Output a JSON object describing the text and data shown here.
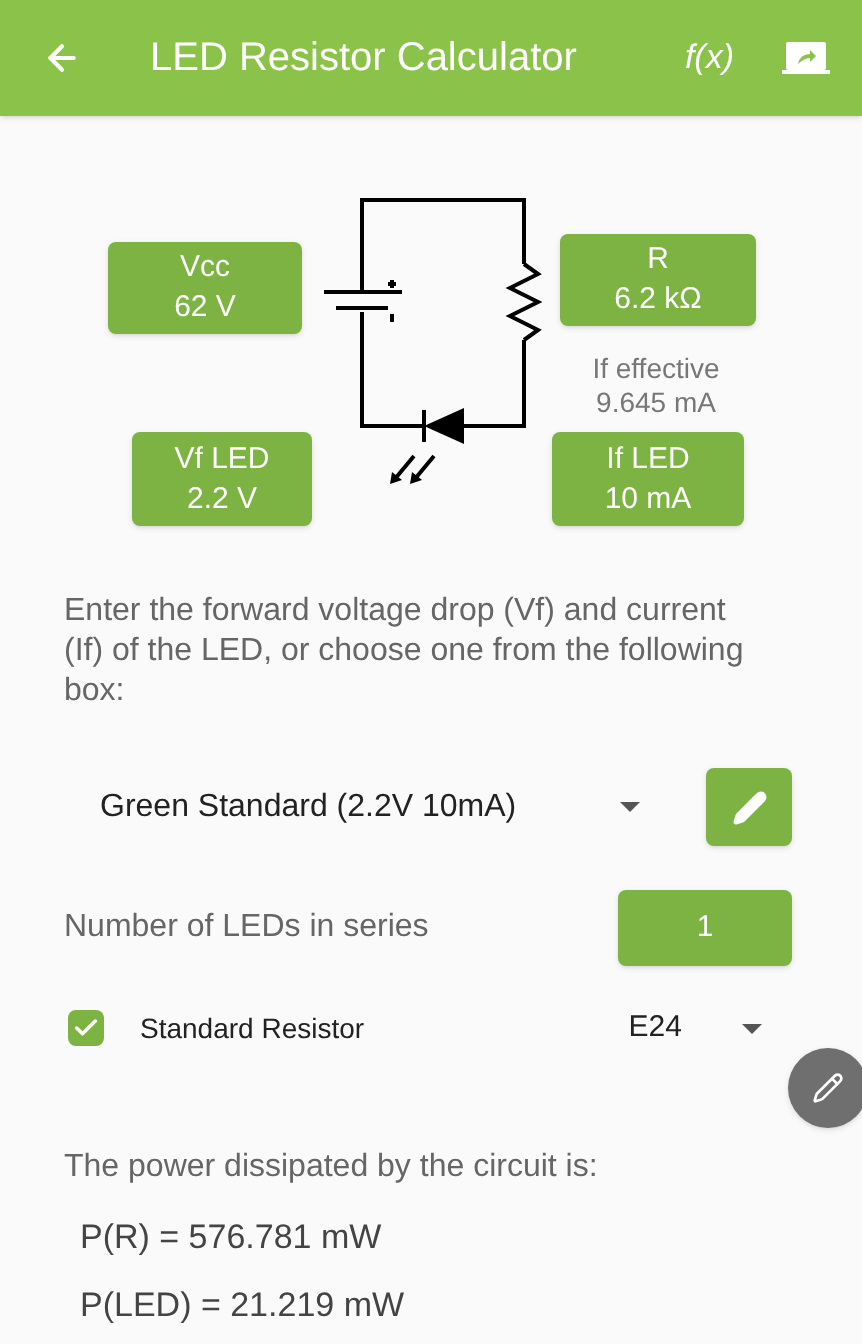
{
  "app_bar": {
    "title": "LED Resistor Calculator",
    "function_label": "f(x)"
  },
  "circuit": {
    "vcc": {
      "label": "Vcc",
      "value": "62 V"
    },
    "r": {
      "label": "R",
      "value": "6.2 kΩ"
    },
    "if_effective": {
      "label": "If effective",
      "value": "9.645 mA"
    },
    "vf_led": {
      "label": "Vf LED",
      "value": "2.2 V"
    },
    "if_led": {
      "label": "If LED",
      "value": "10 mA"
    }
  },
  "instructions": "Enter the forward voltage drop (Vf) and current (If) of the LED, or choose one from the following box:",
  "led_preset": {
    "value": "Green Standard (2.2V 10mA)"
  },
  "series": {
    "label": "Number of LEDs in series",
    "value": "1"
  },
  "standard_resistor": {
    "label": "Standard Resistor",
    "checked": true,
    "series_value": "E24"
  },
  "power": {
    "heading": "The power dissipated by the circuit is:",
    "lines": [
      "P(R) = 576.781 mW",
      "P(LED) = 21.219 mW"
    ]
  }
}
